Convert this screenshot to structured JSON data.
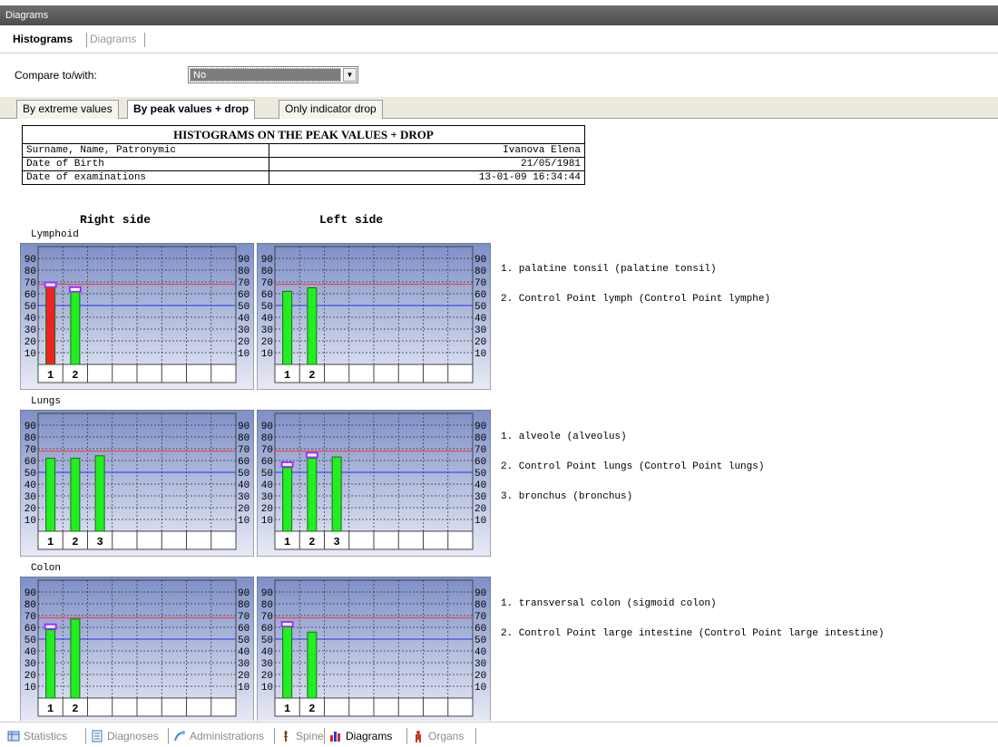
{
  "window": {
    "title": "Diagrams"
  },
  "top_tabs": [
    {
      "label": "Histograms",
      "active": true
    },
    {
      "label": "Diagrams",
      "active": false
    }
  ],
  "compare": {
    "label": "Compare to/with:",
    "value": "No"
  },
  "inner_tabs": [
    {
      "label": "By extreme values",
      "active": false
    },
    {
      "label": "By peak values + drop",
      "active": true
    },
    {
      "label": "Only indicator drop",
      "active": false
    }
  ],
  "report": {
    "title": "HISTOGRAMS ON THE PEAK VALUES + DROP",
    "rows": [
      {
        "label": "Surname, Name, Patronymic",
        "value": "Ivanova Elena"
      },
      {
        "label": "Date of Birth",
        "value": "21/05/1981"
      },
      {
        "label": "Date of examinations",
        "value": "13-01-09 16:34:44"
      }
    ]
  },
  "sides": {
    "right": "Right side",
    "left": "Left side"
  },
  "colors": {
    "chart_bg_top": "#7e8fc7",
    "chart_bg_bottom": "#e8ebf6",
    "bar_ok": "#22ee22",
    "bar_alert": "#ee2222",
    "upper_line": "#ff3333",
    "lower_line": "#2233ee",
    "peak_marker": "#9933ff"
  },
  "chart_data": [
    {
      "type": "bar",
      "title": "Lymphoid",
      "ylim": [
        0,
        100
      ],
      "yticks": [
        10,
        20,
        30,
        40,
        50,
        60,
        70,
        80,
        90
      ],
      "thresholds": {
        "upper": 68,
        "lower": 50
      },
      "categories": [
        "1",
        "2"
      ],
      "legend": [
        "1. palatine tonsil (palatine tonsil)",
        "2. Control Point lymph (Control Point lymphe)"
      ],
      "right": {
        "values": [
          68,
          64
        ],
        "peaks": [
          68,
          64
        ],
        "alert": [
          true,
          false
        ]
      },
      "left": {
        "values": [
          62,
          65
        ],
        "peaks": [
          null,
          null
        ],
        "alert": [
          false,
          false
        ]
      }
    },
    {
      "type": "bar",
      "title": "Lungs",
      "ylim": [
        0,
        100
      ],
      "yticks": [
        10,
        20,
        30,
        40,
        50,
        60,
        70,
        80,
        90
      ],
      "thresholds": {
        "upper": 68,
        "lower": 50
      },
      "categories": [
        "1",
        "2",
        "3"
      ],
      "legend": [
        "1. alveole (alveolus)",
        "2. Control Point lungs (Control Point lungs)",
        "3. bronchus (bronchus)"
      ],
      "right": {
        "values": [
          62,
          62,
          64
        ],
        "peaks": [
          null,
          null,
          null
        ],
        "alert": [
          false,
          false,
          false
        ]
      },
      "left": {
        "values": [
          54,
          62,
          63
        ],
        "peaks": [
          57,
          65,
          null
        ],
        "alert": [
          false,
          false,
          false
        ]
      }
    },
    {
      "type": "bar",
      "title": "Colon",
      "ylim": [
        0,
        100
      ],
      "yticks": [
        10,
        20,
        30,
        40,
        50,
        60,
        70,
        80,
        90
      ],
      "thresholds": {
        "upper": 68,
        "lower": 50
      },
      "categories": [
        "1",
        "2"
      ],
      "legend": [
        "1. transversal colon (sigmoid colon)",
        "2. Control Point large intestine (Control Point large intestine)"
      ],
      "right": {
        "values": [
          58,
          67
        ],
        "peaks": [
          61,
          null
        ],
        "alert": [
          false,
          false
        ]
      },
      "left": {
        "values": [
          61,
          56
        ],
        "peaks": [
          63,
          null
        ],
        "alert": [
          false,
          false
        ]
      }
    }
  ],
  "bottom_tabs": [
    {
      "label": "Statistics",
      "icon": "statistics-icon",
      "active": false
    },
    {
      "label": "Diagnoses",
      "icon": "diagnoses-icon",
      "active": false
    },
    {
      "label": "Administrations",
      "icon": "administrations-icon",
      "active": false
    },
    {
      "label": "Spine",
      "icon": "spine-icon",
      "active": false
    },
    {
      "label": "Diagrams",
      "icon": "diagrams-icon",
      "active": true
    },
    {
      "label": "Organs",
      "icon": "organs-icon",
      "active": false
    }
  ]
}
